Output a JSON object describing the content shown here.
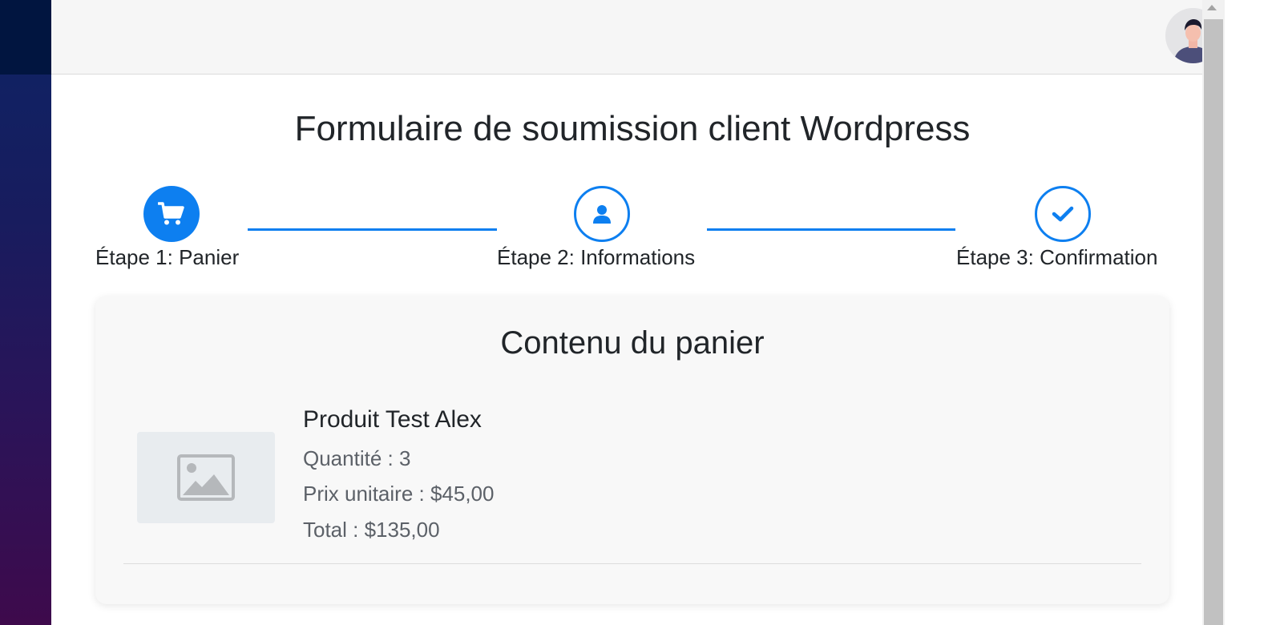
{
  "page": {
    "title": "Formulaire de soumission client Wordpress"
  },
  "header": {
    "avatar_icon": "user-avatar-icon"
  },
  "steps": [
    {
      "label": "Étape 1: Panier",
      "icon": "cart-icon",
      "state": "active"
    },
    {
      "label": "Étape 2: Informations",
      "icon": "user-icon",
      "state": "pending"
    },
    {
      "label": "Étape 3: Confirmation",
      "icon": "check-icon",
      "state": "pending"
    }
  ],
  "cart": {
    "title": "Contenu du panier",
    "items": [
      {
        "name": "Produit Test Alex",
        "quantity_text": "Quantité : 3",
        "unit_price_text": "Prix unitaire : $45,00",
        "total_text": "Total : $135,00",
        "image_icon": "image-placeholder-icon"
      }
    ]
  },
  "colors": {
    "accent": "#0d7ff0",
    "sidebar_top": "#011540",
    "sidebar_gradient_start": "#0d2465",
    "sidebar_gradient_end": "#3e0a4c",
    "card_background": "#f8f8f8",
    "placeholder_background": "#e8ecef"
  }
}
